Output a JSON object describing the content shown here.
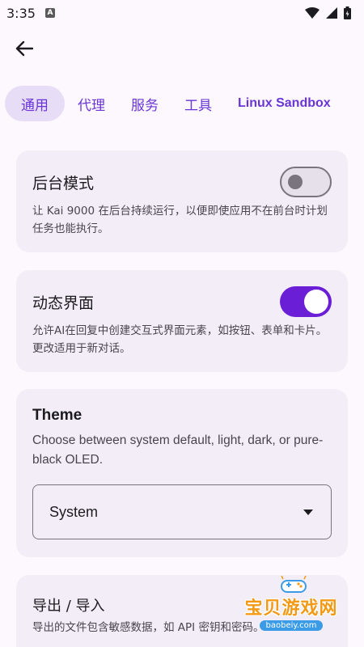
{
  "status_bar": {
    "time": "3:35",
    "indicator": "A",
    "icons": [
      "wifi-icon",
      "signal-icon",
      "battery-icon"
    ]
  },
  "header": {
    "back_icon": "arrow-left-icon"
  },
  "tabs": [
    {
      "label": "通用",
      "active": true
    },
    {
      "label": "代理",
      "active": false
    },
    {
      "label": "服务",
      "active": false
    },
    {
      "label": "工具",
      "active": false
    },
    {
      "label": "Linux Sandbox",
      "active": false
    }
  ],
  "settings": {
    "background_mode": {
      "title": "后台模式",
      "description": "让 Kai 9000 在后台持续运行，以便即使应用不在前台时计划任务也能执行。",
      "enabled": false
    },
    "dynamic_ui": {
      "title": "动态界面",
      "description": "允许AI在回复中创建交互式界面元素，如按钮、表单和卡片。更改适用于新对话。",
      "enabled": true
    },
    "theme": {
      "title": "Theme",
      "description": "Choose between system default, light, dark, or pure-black OLED.",
      "selected": "System"
    },
    "export_import": {
      "title": "导出 / 导入",
      "description": "导出的文件包含敏感数据，如 API 密钥和密码。"
    }
  },
  "watermark": {
    "text": "宝贝游戏网",
    "url": "baobeiy.com"
  },
  "colors": {
    "accent": "#6a1fd6",
    "tab_active_bg": "#e8ddf6",
    "card_bg": "#f3edf7",
    "page_bg": "#fdf8fd"
  }
}
